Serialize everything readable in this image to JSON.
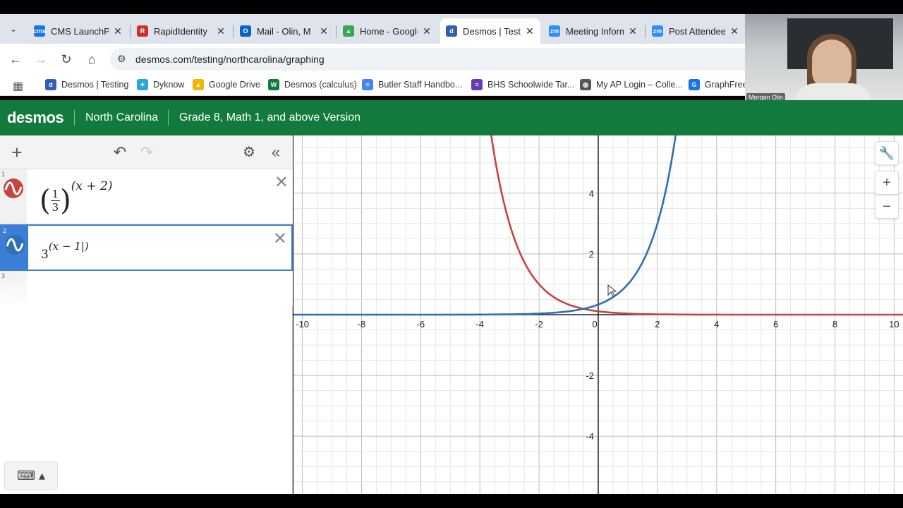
{
  "tabs": [
    {
      "label": "CMS LaunchPad",
      "icon": "cms-launchpad-icon",
      "color": "#1a73e8",
      "glyph": "cms"
    },
    {
      "label": "RapidIdentity",
      "icon": "rapididentity-icon",
      "color": "#d32f2f",
      "glyph": "R"
    },
    {
      "label": "Mail - Olin, M",
      "icon": "outlook-icon",
      "color": "#0a64c8",
      "glyph": "O"
    },
    {
      "label": "Home - Google",
      "icon": "google-drive-icon",
      "color": "#34a853",
      "glyph": "▲"
    },
    {
      "label": "Desmos | Testing",
      "icon": "desmos-icon",
      "color": "#2f5fb3",
      "glyph": "d",
      "active": true
    },
    {
      "label": "Meeting Inform",
      "icon": "zoom-icon",
      "color": "#2d8cff",
      "glyph": "zm"
    },
    {
      "label": "Post Attendee",
      "icon": "zoom-icon",
      "color": "#2d8cff",
      "glyph": "zm"
    }
  ],
  "address": {
    "url": "desmos.com/testing/northcarolina/graphing"
  },
  "bookmarks": [
    {
      "label": "Desmos | Testing",
      "icon": "desmos-icon",
      "color": "#2f5fb3",
      "glyph": "d"
    },
    {
      "label": "Dyknow",
      "icon": "dyknow-icon",
      "color": "#2aa7d8",
      "glyph": "✦"
    },
    {
      "label": "Google Drive",
      "icon": "google-drive-icon",
      "color": "#f4b400",
      "glyph": "▲"
    },
    {
      "label": "Desmos (calculus)",
      "icon": "desmos-calculus-icon",
      "color": "#127a3c",
      "glyph": "W"
    },
    {
      "label": "Butler Staff Handbo...",
      "icon": "google-docs-icon",
      "color": "#4285f4",
      "glyph": "≡"
    },
    {
      "label": "BHS Schoolwide Tar...",
      "icon": "google-forms-icon",
      "color": "#673ab7",
      "glyph": "≡"
    },
    {
      "label": "My AP Login – Colle...",
      "icon": "globe-icon",
      "color": "#555555",
      "glyph": "◍"
    },
    {
      "label": "GraphFree:",
      "icon": "graphfree-icon",
      "color": "#1a73e8",
      "glyph": "G"
    }
  ],
  "webcam": {
    "name": "Morgan Olin"
  },
  "desmos": {
    "logo": "desmos",
    "state": "North Carolina",
    "version": "Grade 8, Math 1, and above Version"
  },
  "expressions": [
    {
      "num": "1",
      "color": "#c74440",
      "base_num": "1",
      "base_den": "3",
      "exponent": "(x + 2)"
    },
    {
      "num": "2",
      "color": "#2d70b3",
      "base": "3",
      "exponent": "(x − 1|)"
    },
    {
      "num": "3"
    }
  ],
  "chart_data": {
    "type": "line",
    "xlim": [
      -10.3,
      10.3
    ],
    "ylim": [
      -5.9,
      5.9
    ],
    "x_ticks": [
      "-10",
      "-8",
      "-6",
      "-4",
      "-2",
      "0",
      "2",
      "4",
      "6",
      "8",
      "10"
    ],
    "y_ticks": [
      "4",
      "2",
      "-2",
      "-4"
    ],
    "grid": true,
    "series": [
      {
        "expr": "(1/3)^(x+2)",
        "color": "#c74440"
      },
      {
        "expr": "3^(x-1)",
        "color": "#2d70b3"
      }
    ]
  }
}
